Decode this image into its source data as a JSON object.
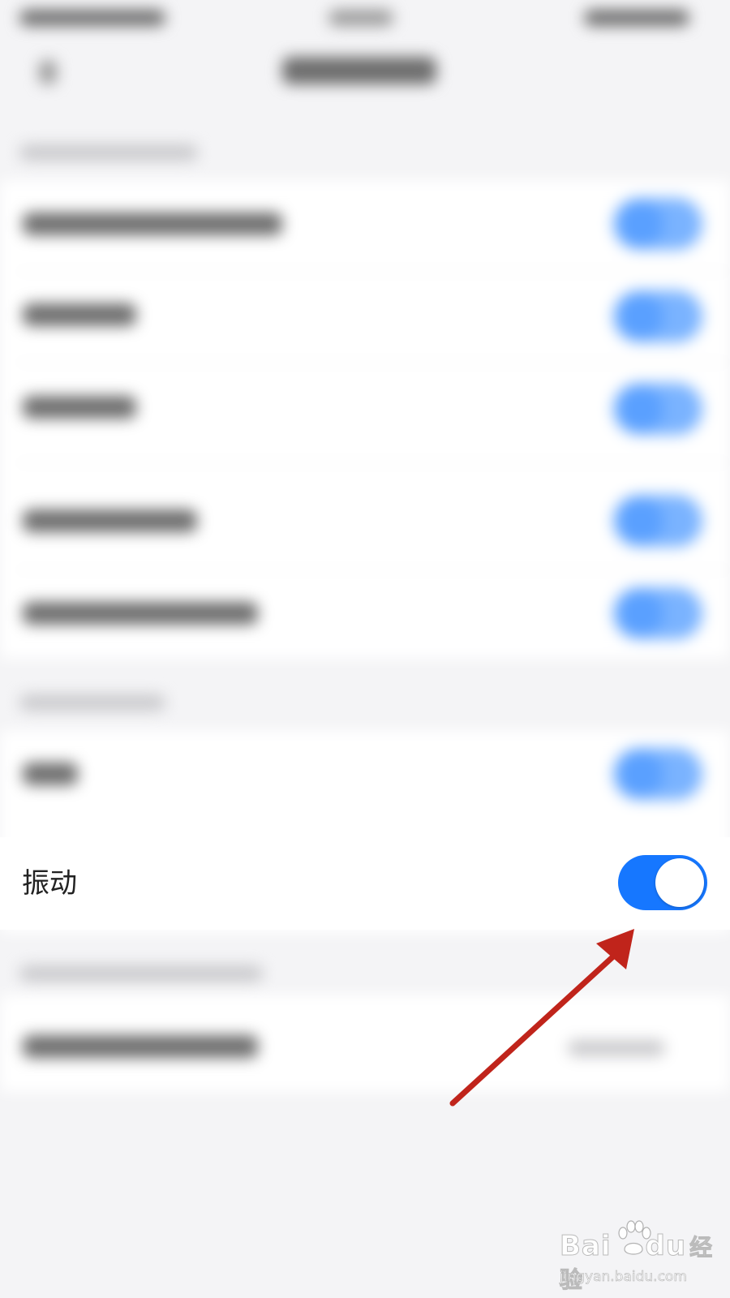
{
  "setting": {
    "vibrate_label": "振动",
    "vibrate_on": true
  },
  "watermark": {
    "logo_text_a": "Bai",
    "logo_text_b": "du",
    "brand_suffix": "经验",
    "url": "jingyan.baidu.com"
  },
  "colors": {
    "toggle_on": "#1677ff",
    "annotation_arrow": "#c0241b",
    "page_bg": "#f4f4f6"
  }
}
